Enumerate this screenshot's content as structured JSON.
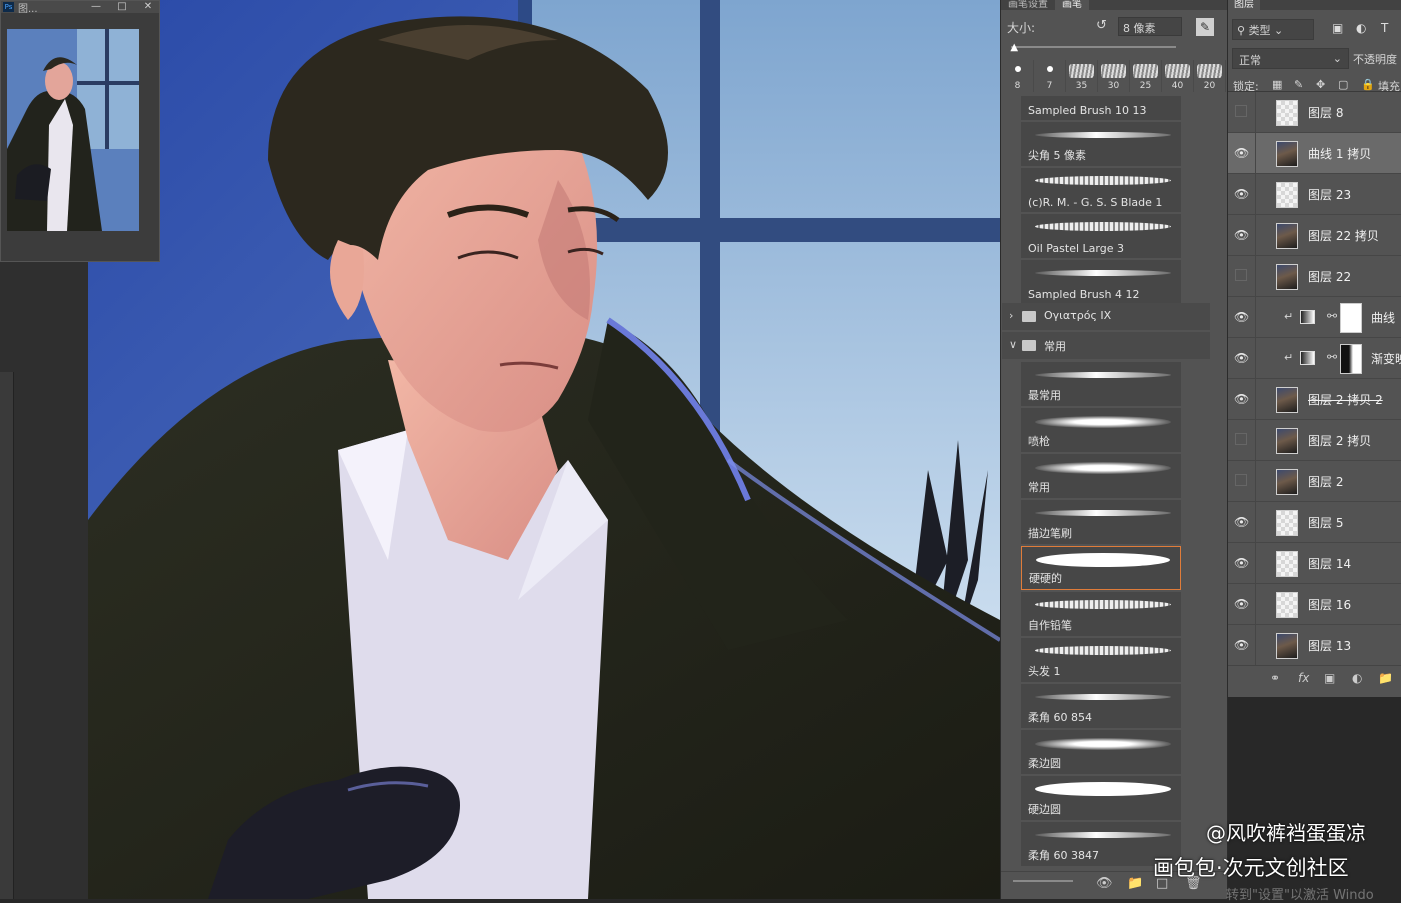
{
  "navigator": {
    "title": "图..."
  },
  "brush_panel": {
    "tabs": [
      "画笔设置",
      "画笔"
    ],
    "size_label": "大小:",
    "size_value": "8 像素",
    "size_fraction": 0.02,
    "presets": [
      {
        "label": "8",
        "tip": "round"
      },
      {
        "label": "7",
        "tip": "round"
      },
      {
        "label": "35",
        "tip": "texture"
      },
      {
        "label": "30",
        "tip": "texture"
      },
      {
        "label": "25",
        "tip": "texture"
      },
      {
        "label": "40",
        "tip": "texture"
      },
      {
        "label": "20",
        "tip": "texture"
      }
    ],
    "brushes_top": [
      {
        "name": "Sampled Brush 10 13",
        "stroke": "thin"
      },
      {
        "name": "尖角 5 像素",
        "stroke": "thin"
      },
      {
        "name": "(c)R. M. - G. S. S Blade 1",
        "stroke": "rough"
      },
      {
        "name": "Oil Pastel Large 3",
        "stroke": "rough"
      },
      {
        "name": "Sampled Brush 4 12",
        "stroke": "thin"
      }
    ],
    "folders": [
      {
        "name": "Ογιατρός IX",
        "expanded": false
      },
      {
        "name": "常用",
        "expanded": true
      }
    ],
    "brushes_common": [
      {
        "name": "最常用",
        "stroke": "thin",
        "selected": false
      },
      {
        "name": "喷枪",
        "stroke": "soft",
        "selected": false
      },
      {
        "name": "常用",
        "stroke": "soft",
        "selected": false
      },
      {
        "name": "描边笔刷",
        "stroke": "thin",
        "selected": false
      },
      {
        "name": "硬硬的",
        "stroke": "thick",
        "selected": true
      },
      {
        "name": "自作铅笔",
        "stroke": "rough",
        "selected": false
      },
      {
        "name": "头发 1",
        "stroke": "rough",
        "selected": false
      },
      {
        "name": "柔角 60 854",
        "stroke": "thin",
        "selected": false
      },
      {
        "name": "柔边圆",
        "stroke": "soft",
        "selected": false
      },
      {
        "name": "硬边圆",
        "stroke": "thick",
        "selected": false
      },
      {
        "name": "柔角 60 3847",
        "stroke": "thin",
        "selected": false
      }
    ]
  },
  "layers_panel": {
    "tab": "图层",
    "filter_label": "类型",
    "blend_mode": "正常",
    "opacity_label": "不透明度",
    "lock_label": "锁定:",
    "fill_label": "填充",
    "layers": [
      {
        "name": "图层 8",
        "visible": false,
        "thumb": "empty",
        "type": "pixel",
        "active": false,
        "strike": false
      },
      {
        "name": "曲线 1 拷贝",
        "visible": true,
        "thumb": "pic",
        "type": "pixel",
        "active": true,
        "strike": false
      },
      {
        "name": "图层 23",
        "visible": true,
        "thumb": "empty",
        "type": "pixel",
        "active": false,
        "strike": false
      },
      {
        "name": "图层 22 拷贝",
        "visible": true,
        "thumb": "pic",
        "type": "pixel",
        "active": false,
        "strike": false
      },
      {
        "name": "图层 22",
        "visible": false,
        "thumb": "pic",
        "type": "pixel",
        "active": false,
        "strike": false
      },
      {
        "name": "曲线",
        "visible": true,
        "thumb": "mask-white",
        "type": "adjustment",
        "active": false,
        "strike": false
      },
      {
        "name": "渐变映",
        "visible": true,
        "thumb": "mask-dark",
        "type": "adjustment",
        "active": false,
        "strike": false
      },
      {
        "name": "图层 2 拷贝 2",
        "visible": true,
        "thumb": "pic",
        "type": "pixel",
        "active": false,
        "strike": true
      },
      {
        "name": "图层 2 拷贝",
        "visible": false,
        "thumb": "pic",
        "type": "pixel",
        "active": false,
        "strike": false
      },
      {
        "name": "图层 2",
        "visible": false,
        "thumb": "pic",
        "type": "pixel",
        "active": false,
        "strike": false
      },
      {
        "name": "图层 5",
        "visible": true,
        "thumb": "empty",
        "type": "pixel",
        "active": false,
        "strike": false
      },
      {
        "name": "图层 14",
        "visible": true,
        "thumb": "empty",
        "type": "pixel",
        "active": false,
        "strike": false
      },
      {
        "name": "图层 16",
        "visible": true,
        "thumb": "empty",
        "type": "pixel",
        "active": false,
        "strike": false
      },
      {
        "name": "图层 13",
        "visible": true,
        "thumb": "pic",
        "type": "pixel",
        "active": false,
        "strike": false
      }
    ]
  },
  "watermark": {
    "line1": "@风吹裤裆蛋蛋凉",
    "line2": "画包包·次元文创社区",
    "line3": "转到\"设置\"以激活 Windo"
  }
}
